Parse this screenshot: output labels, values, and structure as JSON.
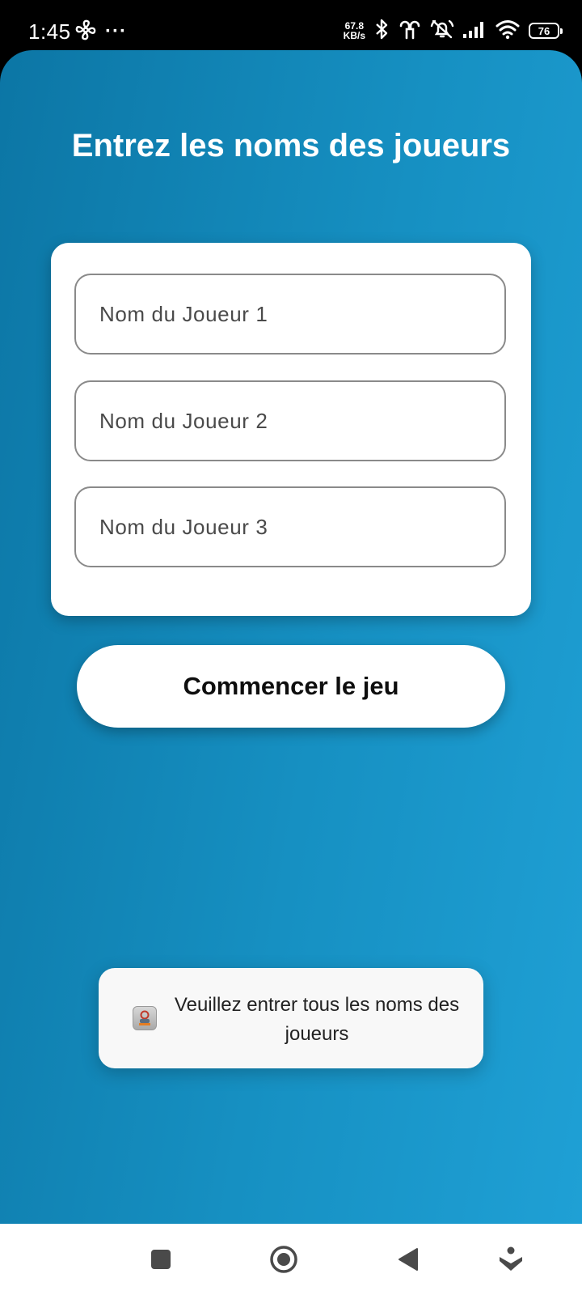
{
  "status_bar": {
    "time": "1:45",
    "more_indicator": "···",
    "net_speed_value": "67.8",
    "net_speed_unit": "KB/s",
    "battery_level": "76",
    "icons": [
      "fan-icon",
      "bluetooth-icon",
      "earbuds-icon",
      "alarm-off-icon",
      "signal-icon",
      "wifi-icon",
      "battery-icon"
    ]
  },
  "main": {
    "title": "Entrez les noms des joueurs",
    "fields": [
      {
        "placeholder": "Nom du Joueur 1",
        "value": ""
      },
      {
        "placeholder": "Nom du Joueur 2",
        "value": ""
      },
      {
        "placeholder": "Nom du Joueur 3",
        "value": ""
      }
    ],
    "start_button_label": "Commencer le jeu"
  },
  "toast": {
    "icon": "app-icon",
    "message": "Veuillez entrer tous les noms des joueurs"
  },
  "nav_bar": {
    "buttons": [
      "recents-square-icon",
      "home-circle-icon",
      "back-triangle-icon",
      "assistant-icon"
    ]
  },
  "colors": {
    "background_gradient_start": "#0c76a5",
    "background_gradient_end": "#1fa0d5",
    "card": "#ffffff",
    "toast_background": "#f8f8f8",
    "title_text": "#ffffff"
  }
}
